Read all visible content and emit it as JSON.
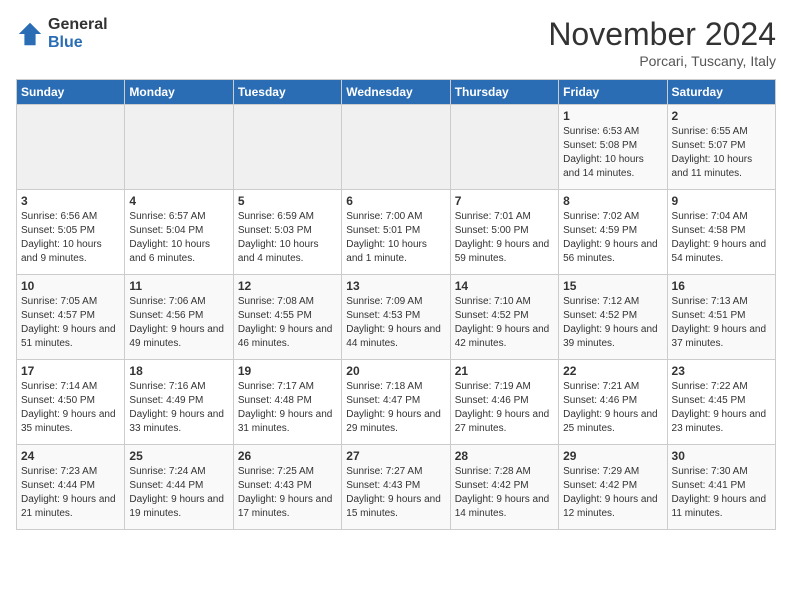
{
  "header": {
    "logo_general": "General",
    "logo_blue": "Blue",
    "month_title": "November 2024",
    "location": "Porcari, Tuscany, Italy"
  },
  "weekdays": [
    "Sunday",
    "Monday",
    "Tuesday",
    "Wednesday",
    "Thursday",
    "Friday",
    "Saturday"
  ],
  "weeks": [
    [
      {
        "day": "",
        "info": ""
      },
      {
        "day": "",
        "info": ""
      },
      {
        "day": "",
        "info": ""
      },
      {
        "day": "",
        "info": ""
      },
      {
        "day": "",
        "info": ""
      },
      {
        "day": "1",
        "info": "Sunrise: 6:53 AM\nSunset: 5:08 PM\nDaylight: 10 hours and 14 minutes."
      },
      {
        "day": "2",
        "info": "Sunrise: 6:55 AM\nSunset: 5:07 PM\nDaylight: 10 hours and 11 minutes."
      }
    ],
    [
      {
        "day": "3",
        "info": "Sunrise: 6:56 AM\nSunset: 5:05 PM\nDaylight: 10 hours and 9 minutes."
      },
      {
        "day": "4",
        "info": "Sunrise: 6:57 AM\nSunset: 5:04 PM\nDaylight: 10 hours and 6 minutes."
      },
      {
        "day": "5",
        "info": "Sunrise: 6:59 AM\nSunset: 5:03 PM\nDaylight: 10 hours and 4 minutes."
      },
      {
        "day": "6",
        "info": "Sunrise: 7:00 AM\nSunset: 5:01 PM\nDaylight: 10 hours and 1 minute."
      },
      {
        "day": "7",
        "info": "Sunrise: 7:01 AM\nSunset: 5:00 PM\nDaylight: 9 hours and 59 minutes."
      },
      {
        "day": "8",
        "info": "Sunrise: 7:02 AM\nSunset: 4:59 PM\nDaylight: 9 hours and 56 minutes."
      },
      {
        "day": "9",
        "info": "Sunrise: 7:04 AM\nSunset: 4:58 PM\nDaylight: 9 hours and 54 minutes."
      }
    ],
    [
      {
        "day": "10",
        "info": "Sunrise: 7:05 AM\nSunset: 4:57 PM\nDaylight: 9 hours and 51 minutes."
      },
      {
        "day": "11",
        "info": "Sunrise: 7:06 AM\nSunset: 4:56 PM\nDaylight: 9 hours and 49 minutes."
      },
      {
        "day": "12",
        "info": "Sunrise: 7:08 AM\nSunset: 4:55 PM\nDaylight: 9 hours and 46 minutes."
      },
      {
        "day": "13",
        "info": "Sunrise: 7:09 AM\nSunset: 4:53 PM\nDaylight: 9 hours and 44 minutes."
      },
      {
        "day": "14",
        "info": "Sunrise: 7:10 AM\nSunset: 4:52 PM\nDaylight: 9 hours and 42 minutes."
      },
      {
        "day": "15",
        "info": "Sunrise: 7:12 AM\nSunset: 4:52 PM\nDaylight: 9 hours and 39 minutes."
      },
      {
        "day": "16",
        "info": "Sunrise: 7:13 AM\nSunset: 4:51 PM\nDaylight: 9 hours and 37 minutes."
      }
    ],
    [
      {
        "day": "17",
        "info": "Sunrise: 7:14 AM\nSunset: 4:50 PM\nDaylight: 9 hours and 35 minutes."
      },
      {
        "day": "18",
        "info": "Sunrise: 7:16 AM\nSunset: 4:49 PM\nDaylight: 9 hours and 33 minutes."
      },
      {
        "day": "19",
        "info": "Sunrise: 7:17 AM\nSunset: 4:48 PM\nDaylight: 9 hours and 31 minutes."
      },
      {
        "day": "20",
        "info": "Sunrise: 7:18 AM\nSunset: 4:47 PM\nDaylight: 9 hours and 29 minutes."
      },
      {
        "day": "21",
        "info": "Sunrise: 7:19 AM\nSunset: 4:46 PM\nDaylight: 9 hours and 27 minutes."
      },
      {
        "day": "22",
        "info": "Sunrise: 7:21 AM\nSunset: 4:46 PM\nDaylight: 9 hours and 25 minutes."
      },
      {
        "day": "23",
        "info": "Sunrise: 7:22 AM\nSunset: 4:45 PM\nDaylight: 9 hours and 23 minutes."
      }
    ],
    [
      {
        "day": "24",
        "info": "Sunrise: 7:23 AM\nSunset: 4:44 PM\nDaylight: 9 hours and 21 minutes."
      },
      {
        "day": "25",
        "info": "Sunrise: 7:24 AM\nSunset: 4:44 PM\nDaylight: 9 hours and 19 minutes."
      },
      {
        "day": "26",
        "info": "Sunrise: 7:25 AM\nSunset: 4:43 PM\nDaylight: 9 hours and 17 minutes."
      },
      {
        "day": "27",
        "info": "Sunrise: 7:27 AM\nSunset: 4:43 PM\nDaylight: 9 hours and 15 minutes."
      },
      {
        "day": "28",
        "info": "Sunrise: 7:28 AM\nSunset: 4:42 PM\nDaylight: 9 hours and 14 minutes."
      },
      {
        "day": "29",
        "info": "Sunrise: 7:29 AM\nSunset: 4:42 PM\nDaylight: 9 hours and 12 minutes."
      },
      {
        "day": "30",
        "info": "Sunrise: 7:30 AM\nSunset: 4:41 PM\nDaylight: 9 hours and 11 minutes."
      }
    ]
  ]
}
